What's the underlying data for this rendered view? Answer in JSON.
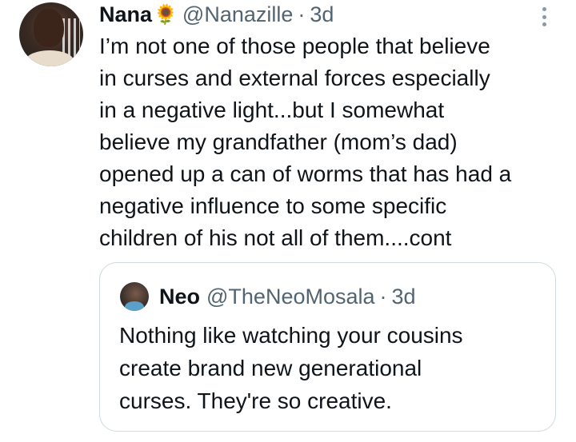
{
  "tweet": {
    "author": {
      "name": "Nana",
      "emoji": "🌻",
      "handle": "@Nanazille",
      "separator": "·",
      "time": "3d"
    },
    "lines": [
      "I’m not one of those people that believe",
      "in curses and external forces especially",
      "in a negative light...but I somewhat",
      "believe my grandfather (mom’s dad)",
      "opened up a can of worms that has had a",
      "negative influence to some specific",
      "children of his not all of them....cont"
    ],
    "more_icon": "more-vertical-icon"
  },
  "quoted_tweet": {
    "author": {
      "name": "Neo",
      "handle": "@TheNeoMosala",
      "separator": "·",
      "time": "3d"
    },
    "lines": [
      "Nothing like watching your cousins",
      "create brand new generational",
      "curses. They're so creative."
    ]
  },
  "colors": {
    "text": "#0f1419",
    "secondary": "#536471",
    "border": "#cfd9de",
    "background": "#ffffff"
  }
}
